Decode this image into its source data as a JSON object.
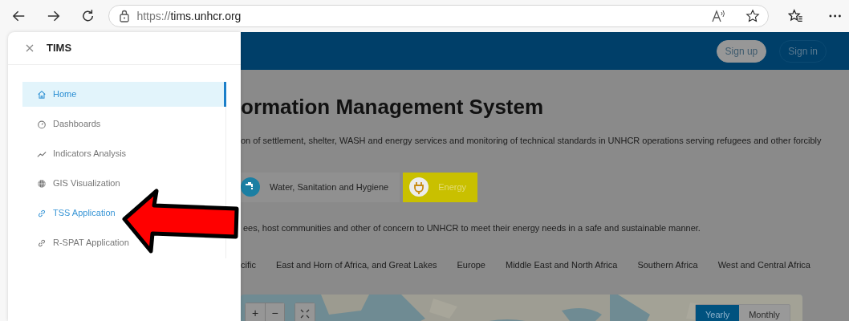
{
  "browser": {
    "url": {
      "scheme": "https://",
      "host": "tims.unhcr.org"
    }
  },
  "sidebar": {
    "title": "TIMS",
    "items": [
      {
        "label": "Home",
        "selected": true,
        "hovered": false
      },
      {
        "label": "Dashboards",
        "selected": false,
        "hovered": false
      },
      {
        "label": "Indicators Analysis",
        "selected": false,
        "hovered": false
      },
      {
        "label": "GIS Visualization",
        "selected": false,
        "hovered": false
      },
      {
        "label": "TSS Application",
        "selected": false,
        "hovered": true
      },
      {
        "label": "R-SPAT Application",
        "selected": false,
        "hovered": false
      }
    ]
  },
  "header": {
    "buttons": [
      {
        "label": "Sign up",
        "kind": "filled"
      },
      {
        "label": "Sign in",
        "kind": "outline"
      }
    ]
  },
  "page": {
    "title": "ormation Management System",
    "description": "on of settlement, shelter, WASH and energy services and monitoring of technical standards in UNHCR operations serving refugees and other forcibly",
    "categories": [
      {
        "label": "Water, Sanitation and Hygiene",
        "selected": false
      },
      {
        "label": "Energy",
        "selected": true
      }
    ],
    "category_text": "ees, host communities and other of concern to UNHCR to meet their energy needs in a safe and sustainable manner.",
    "regions": [
      {
        "label": "cific"
      },
      {
        "label": "East and Horn of Africa, and Great Lakes"
      },
      {
        "label": "Europe"
      },
      {
        "label": "Middle East and North Africa"
      },
      {
        "label": "Southern Africa"
      },
      {
        "label": "West and Central Africa"
      }
    ],
    "map": {
      "zoom_in": "+",
      "zoom_out": "−",
      "periods": [
        {
          "label": "Yearly",
          "selected": true
        },
        {
          "label": "Monthly",
          "selected": false
        }
      ]
    }
  }
}
